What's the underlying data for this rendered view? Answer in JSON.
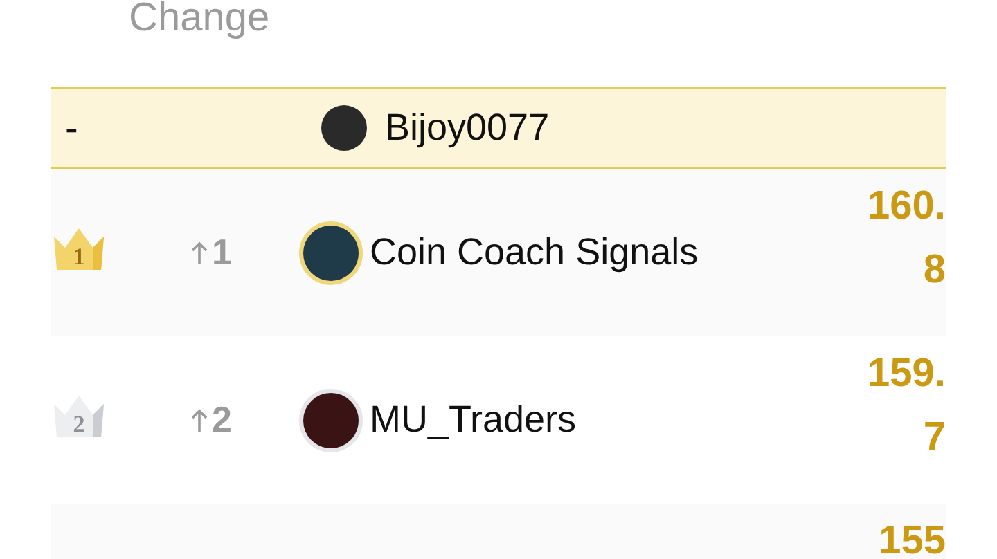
{
  "header": {
    "change_label": "Change"
  },
  "my_row": {
    "rank": "-",
    "name": "Bijoy0077"
  },
  "rows": [
    {
      "kind": "gold",
      "rank": "1",
      "change": "1",
      "name": "Coin Coach Signals",
      "score": "160.8"
    },
    {
      "kind": "silver",
      "rank": "2",
      "change": "2",
      "name": "MU_Traders",
      "score": "159.7"
    },
    {
      "score": "155"
    }
  ]
}
